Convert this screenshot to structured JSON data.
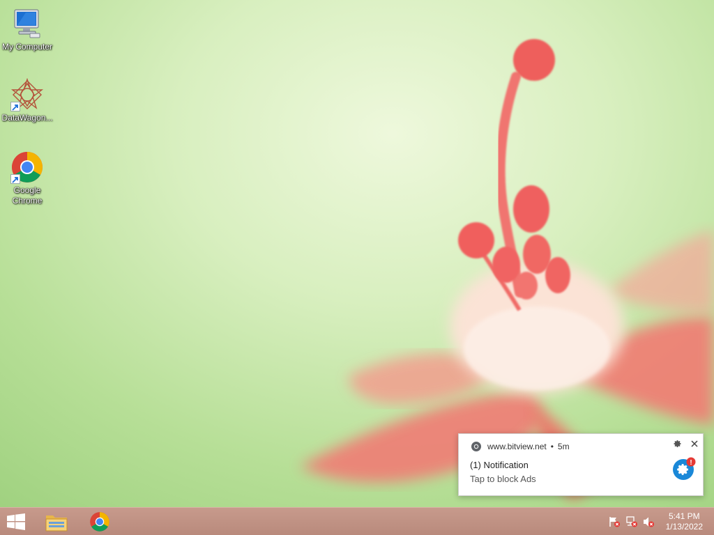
{
  "desktop": {
    "icons": [
      {
        "label": "My Computer"
      },
      {
        "label": "DataWagon..."
      },
      {
        "label": "Google Chrome"
      }
    ]
  },
  "notification": {
    "site": "www.bitview.net",
    "separator": "•",
    "age": "5m",
    "title": "(1) Notification",
    "body": "Tap to block Ads",
    "badge": "!"
  },
  "taskbar": {
    "clock": {
      "time": "5:41 PM",
      "date": "1/13/2022"
    }
  },
  "colors": {
    "accent_blue": "#1a88d8",
    "badge_red": "#e53935",
    "taskbar": "#c29486"
  },
  "icons": {
    "start": "windows-logo-icon",
    "explorer": "folder-icon",
    "chrome": "chrome-icon",
    "tray": [
      "action-center-flag-icon",
      "network-icon",
      "volume-muted-icon"
    ]
  }
}
